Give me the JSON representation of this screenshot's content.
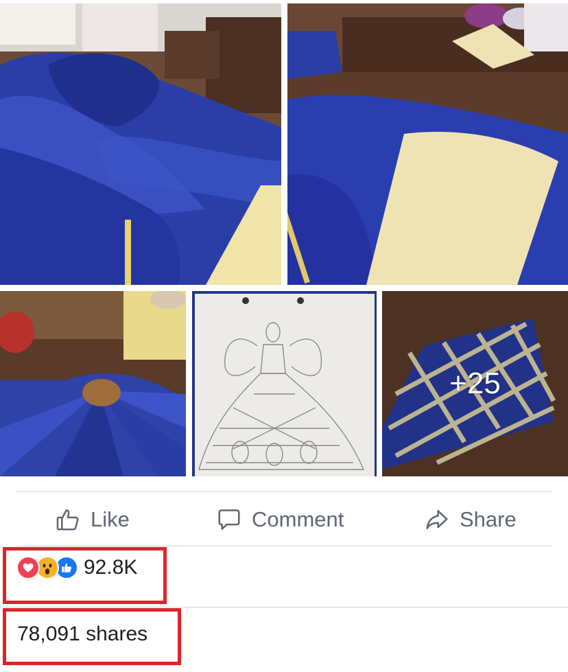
{
  "post": {
    "photos": [
      {
        "name": "photo-blue-satin-fabric"
      },
      {
        "name": "photo-pattern-on-fabric"
      },
      {
        "name": "photo-skirt-panels"
      },
      {
        "name": "photo-gown-sketch"
      },
      {
        "name": "photo-quilted-panel",
        "more_label": "+25"
      }
    ]
  },
  "actions": {
    "like_label": "Like",
    "comment_label": "Comment",
    "share_label": "Share"
  },
  "stats": {
    "reactions_count": "92.8K",
    "shares_text": "78,091 shares",
    "reaction_types": [
      "heart",
      "wow",
      "like"
    ]
  },
  "colors": {
    "action_text": "#606770",
    "highlight": "#e0232b",
    "satin": "#2a3fa3",
    "pattern_paper": "#efe3b4"
  }
}
